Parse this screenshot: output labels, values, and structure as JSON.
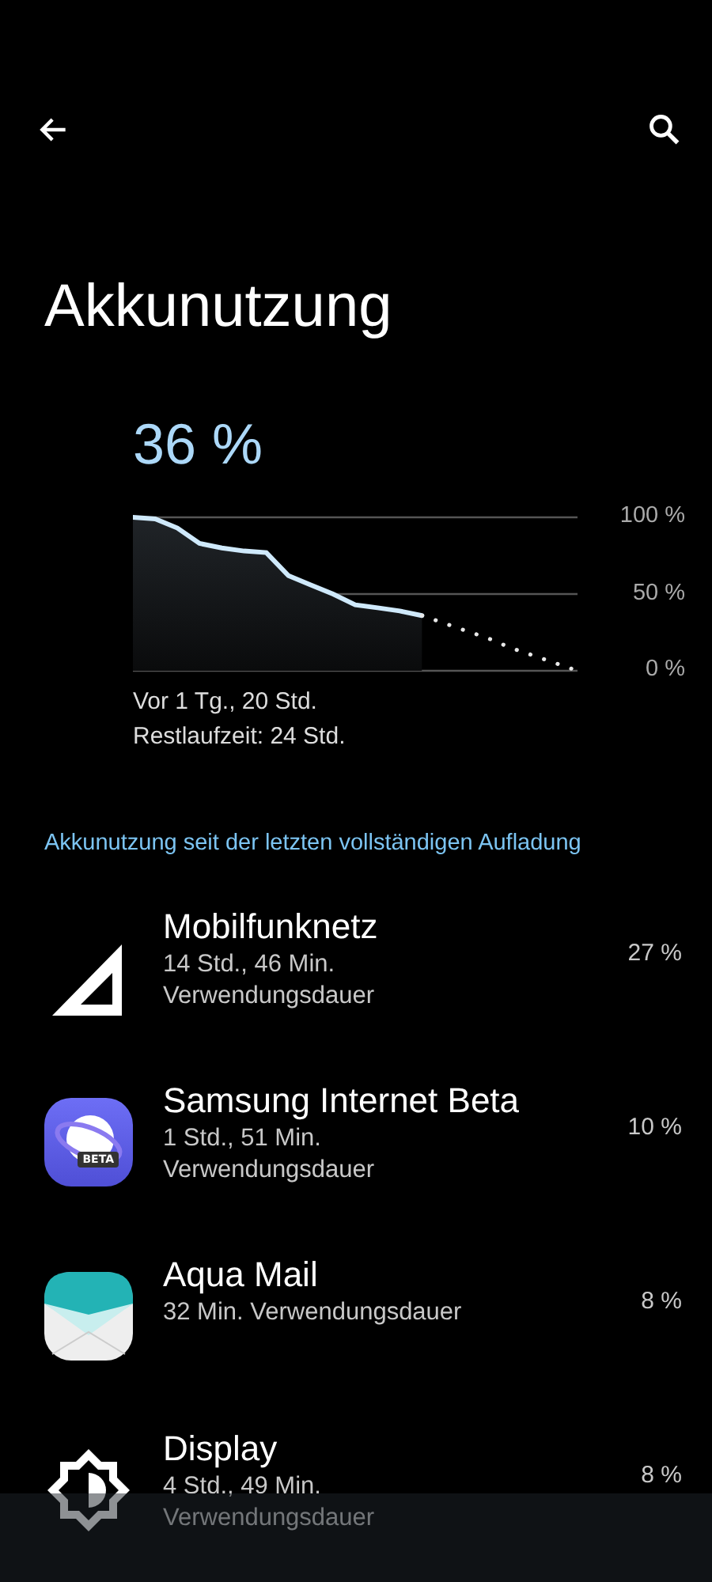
{
  "title": "Akkunutzung",
  "battery": {
    "percent": "36 %",
    "chart_data": {
      "type": "area",
      "categories": [
        null,
        null,
        null,
        null,
        null,
        null,
        null,
        null,
        null,
        null,
        null,
        null,
        null,
        null,
        null,
        null,
        null,
        null,
        null,
        null,
        null
      ],
      "ylim": [
        0,
        100
      ],
      "yticks": [
        {
          "value": 100,
          "label": "100 %"
        },
        {
          "value": 50,
          "label": "50 %"
        },
        {
          "value": 0,
          "label": "0 %"
        }
      ],
      "series": [
        {
          "color": "#cfe9fb",
          "line_style": "solid",
          "type": "area",
          "values": [
            100,
            99,
            93,
            83,
            80,
            78,
            77,
            62,
            56,
            50,
            43,
            41,
            39,
            36,
            null,
            null,
            null,
            null,
            null,
            null,
            null
          ]
        },
        {
          "color": "#e8e8e8",
          "line_style": "dotted",
          "type": "line",
          "values": [
            null,
            null,
            null,
            null,
            null,
            null,
            null,
            null,
            null,
            null,
            null,
            null,
            null,
            36,
            31,
            26,
            21,
            15,
            10,
            5,
            0
          ]
        }
      ]
    },
    "since": "Vor 1 Tg., 20 Std.",
    "remaining": "Restlaufzeit: 24 Std."
  },
  "section_header": "Akkunutzung seit der letzten vollständigen Aufladung",
  "apps": [
    {
      "kind": "signal",
      "name": "Mobilfunknetz",
      "usage": [
        "14 Std., 46 Min.",
        "Verwendungsdauer"
      ],
      "percent": "27 %"
    },
    {
      "kind": "browser",
      "badge": "BETA",
      "name": "Samsung Internet Beta",
      "usage": [
        "1 Std., 51 Min.",
        "Verwendungsdauer"
      ],
      "percent": "10 %"
    },
    {
      "kind": "mail",
      "name": "Aqua Mail",
      "usage": [
        "32 Min. Verwendungsdauer"
      ],
      "percent": "8 %"
    },
    {
      "kind": "display",
      "name": "Display",
      "usage": [
        "4 Std., 49 Min.",
        "Verwendungsdauer"
      ],
      "percent": "8 %"
    }
  ]
}
